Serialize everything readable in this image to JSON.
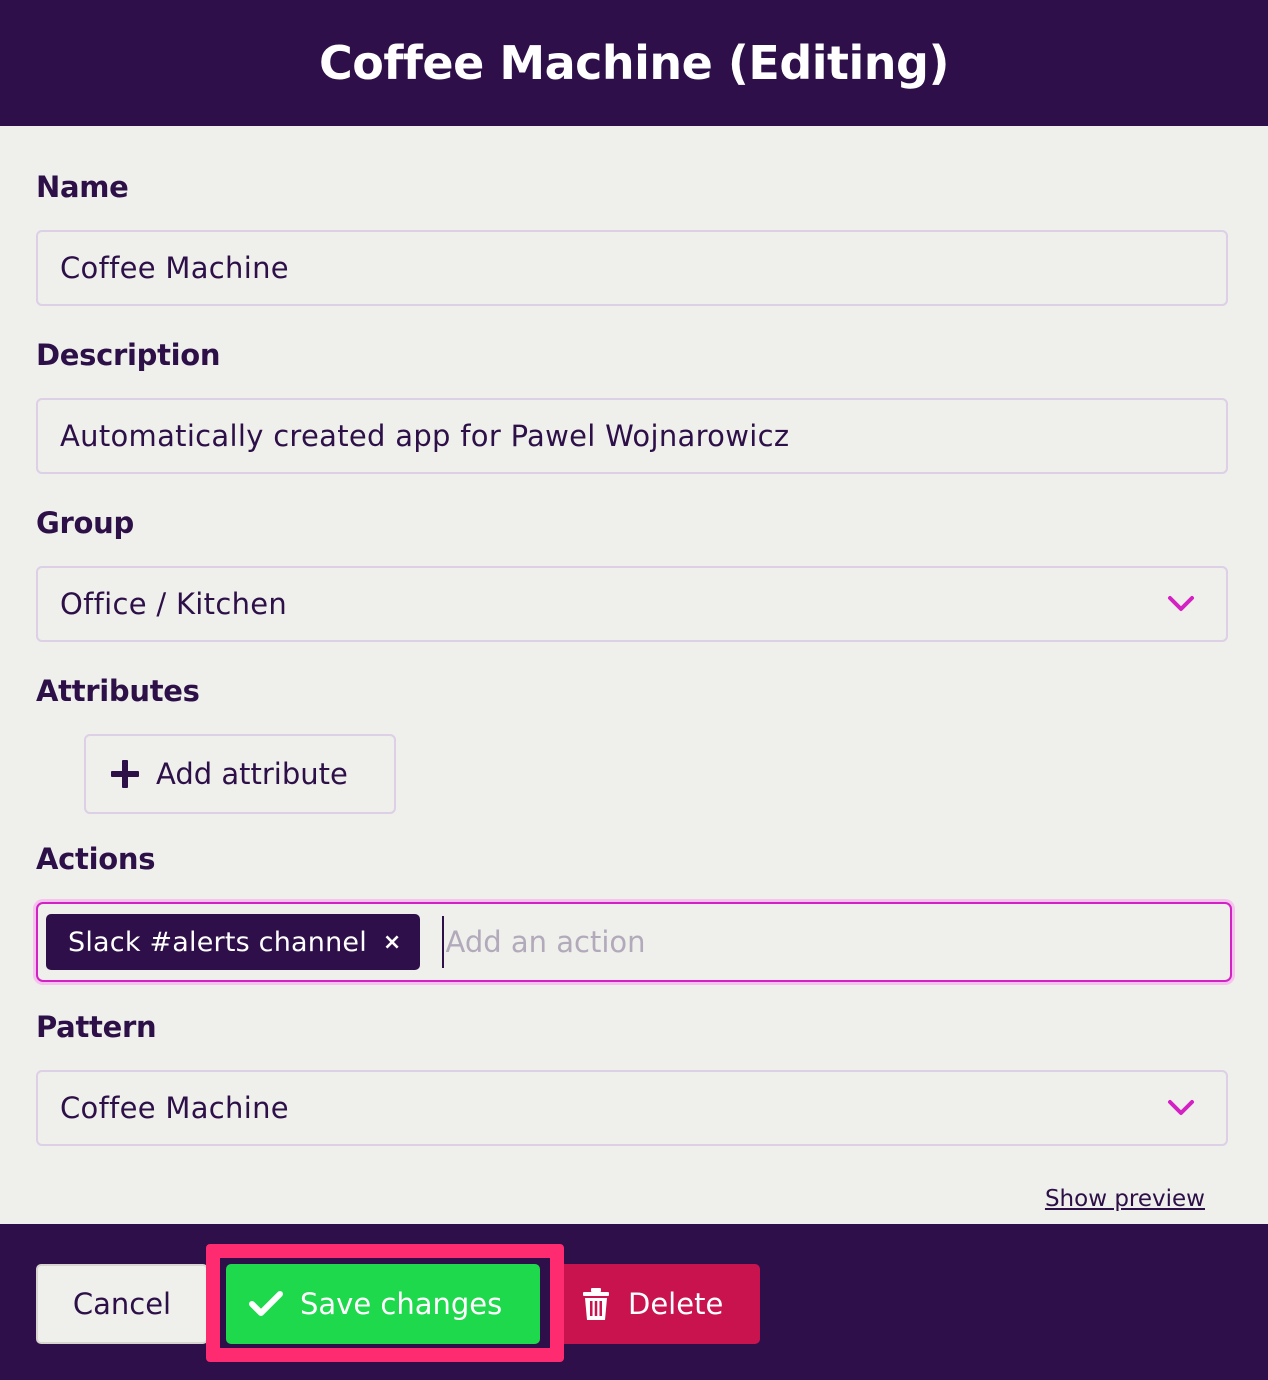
{
  "header": {
    "title": "Coffee Machine (Editing)"
  },
  "form": {
    "name": {
      "label": "Name",
      "value": "Coffee Machine"
    },
    "description": {
      "label": "Description",
      "value": "Automatically created app for Pawel Wojnarowicz"
    },
    "group": {
      "label": "Group",
      "value": "Office / Kitchen"
    },
    "attributes": {
      "label": "Attributes",
      "add_button": "Add attribute"
    },
    "actions": {
      "label": "Actions",
      "tags": [
        "Slack #alerts channel"
      ],
      "tag_remove_glyph": "×",
      "placeholder": "Add an action"
    },
    "pattern": {
      "label": "Pattern",
      "value": "Coffee Machine"
    },
    "show_preview": "Show preview"
  },
  "footer": {
    "cancel_label": "Cancel",
    "save_label": "Save changes",
    "delete_label": "Delete"
  },
  "colors": {
    "primary": "#2e0f49",
    "save": "#1fd94d",
    "delete": "#c8134f",
    "highlight": "#ff2b70",
    "accent": "#d321c4"
  },
  "icons": [
    "chevron-down-icon",
    "plus-icon",
    "close-icon",
    "check-icon",
    "trash-icon"
  ]
}
